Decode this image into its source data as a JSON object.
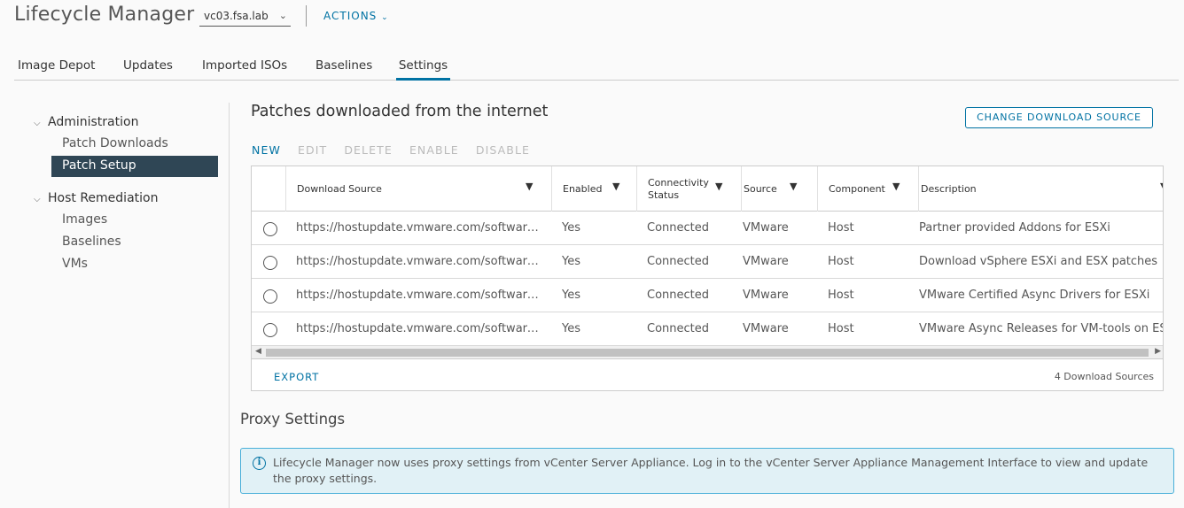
{
  "header": {
    "app_title": "Lifecycle Manager",
    "vcenter": "vc03.fsa.lab",
    "actions_label": "ACTIONS"
  },
  "tabs": [
    {
      "label": "Image Depot"
    },
    {
      "label": "Updates"
    },
    {
      "label": "Imported ISOs"
    },
    {
      "label": "Baselines"
    },
    {
      "label": "Settings",
      "active": true
    }
  ],
  "sidebar": {
    "groups": [
      {
        "label": "Administration",
        "items": [
          {
            "label": "Patch Downloads"
          },
          {
            "label": "Patch Setup",
            "active": true
          }
        ]
      },
      {
        "label": "Host Remediation",
        "items": [
          {
            "label": "Images"
          },
          {
            "label": "Baselines"
          },
          {
            "label": "VMs"
          }
        ]
      }
    ]
  },
  "main": {
    "title": "Patches downloaded from the internet",
    "change_source_label": "CHANGE DOWNLOAD SOURCE",
    "toolbar": {
      "new": "NEW",
      "edit": "EDIT",
      "delete": "DELETE",
      "enable": "ENABLE",
      "disable": "DISABLE"
    },
    "grid": {
      "columns": {
        "download_source": "Download Source",
        "enabled": "Enabled",
        "connectivity_line1": "Connectivity",
        "connectivity_line2": "Status",
        "source": "Source",
        "component": "Component",
        "description": "Description"
      },
      "rows": [
        {
          "url": "https://hostupdate.vmware.com/software/...",
          "enabled": "Yes",
          "status": "Connected",
          "source": "VMware",
          "component": "Host",
          "description": "Partner provided Addons for ESXi"
        },
        {
          "url": "https://hostupdate.vmware.com/software/...",
          "enabled": "Yes",
          "status": "Connected",
          "source": "VMware",
          "component": "Host",
          "description": "Download vSphere ESXi and ESX patches"
        },
        {
          "url": "https://hostupdate.vmware.com/software/...",
          "enabled": "Yes",
          "status": "Connected",
          "source": "VMware",
          "component": "Host",
          "description": "VMware Certified Async Drivers for ESXi"
        },
        {
          "url": "https://hostupdate.vmware.com/software/...",
          "enabled": "Yes",
          "status": "Connected",
          "source": "VMware",
          "component": "Host",
          "description": "VMware Async Releases for VM-tools on ESXi"
        }
      ],
      "export_label": "EXPORT",
      "count_label": "4 Download Sources"
    }
  },
  "proxy": {
    "title": "Proxy Settings",
    "info_text": "Lifecycle Manager now uses proxy settings from vCenter Server Appliance. Log in to the vCenter Server Appliance Management Interface to view and update the proxy settings."
  },
  "colors": {
    "accent": "#0072a3",
    "sidebar_active": "#2f4655",
    "info_bg": "#e1f1f6",
    "info_border": "#49afd9"
  }
}
